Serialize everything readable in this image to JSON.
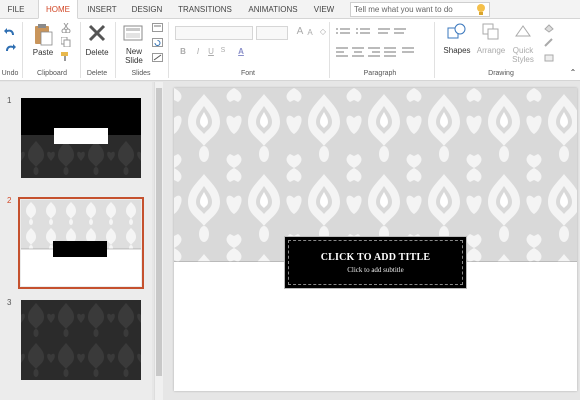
{
  "tabs": {
    "file": "FILE",
    "home": "HOME",
    "insert": "INSERT",
    "design": "DESIGN",
    "transitions": "TRANSITIONS",
    "animations": "ANIMATIONS",
    "view": "VIEW"
  },
  "tell_me": {
    "placeholder": "Tell me what you want to do"
  },
  "ribbon": {
    "undo_group": "Undo",
    "clipboard": {
      "paste": "Paste",
      "label": "Clipboard"
    },
    "delete": {
      "button": "Delete",
      "label": "Delete"
    },
    "slides": {
      "new_slide_line1": "New",
      "new_slide_line2": "Slide",
      "label": "Slides"
    },
    "font": {
      "bold": "B",
      "italic": "I",
      "underline": "U",
      "strike": "abc",
      "font_color": "A",
      "label": "Font"
    },
    "paragraph": {
      "label": "Paragraph"
    },
    "drawing": {
      "shapes": "Shapes",
      "arrange": "Arrange",
      "quick_styles_line1": "Quick",
      "quick_styles_line2": "Styles",
      "label": "Drawing"
    }
  },
  "thumbnails": [
    {
      "number": "1",
      "selected": false
    },
    {
      "number": "2",
      "selected": true
    },
    {
      "number": "3",
      "selected": false
    }
  ],
  "slide": {
    "title": "CLICK TO ADD TITLE",
    "subtitle": "Click to add subtitle"
  },
  "colors": {
    "accent": "#d24726",
    "selection_border": "#c5512e",
    "damask_bg": "#d9d9d9",
    "title_box": "#000000",
    "dark_slide": "#2b2b2b"
  }
}
